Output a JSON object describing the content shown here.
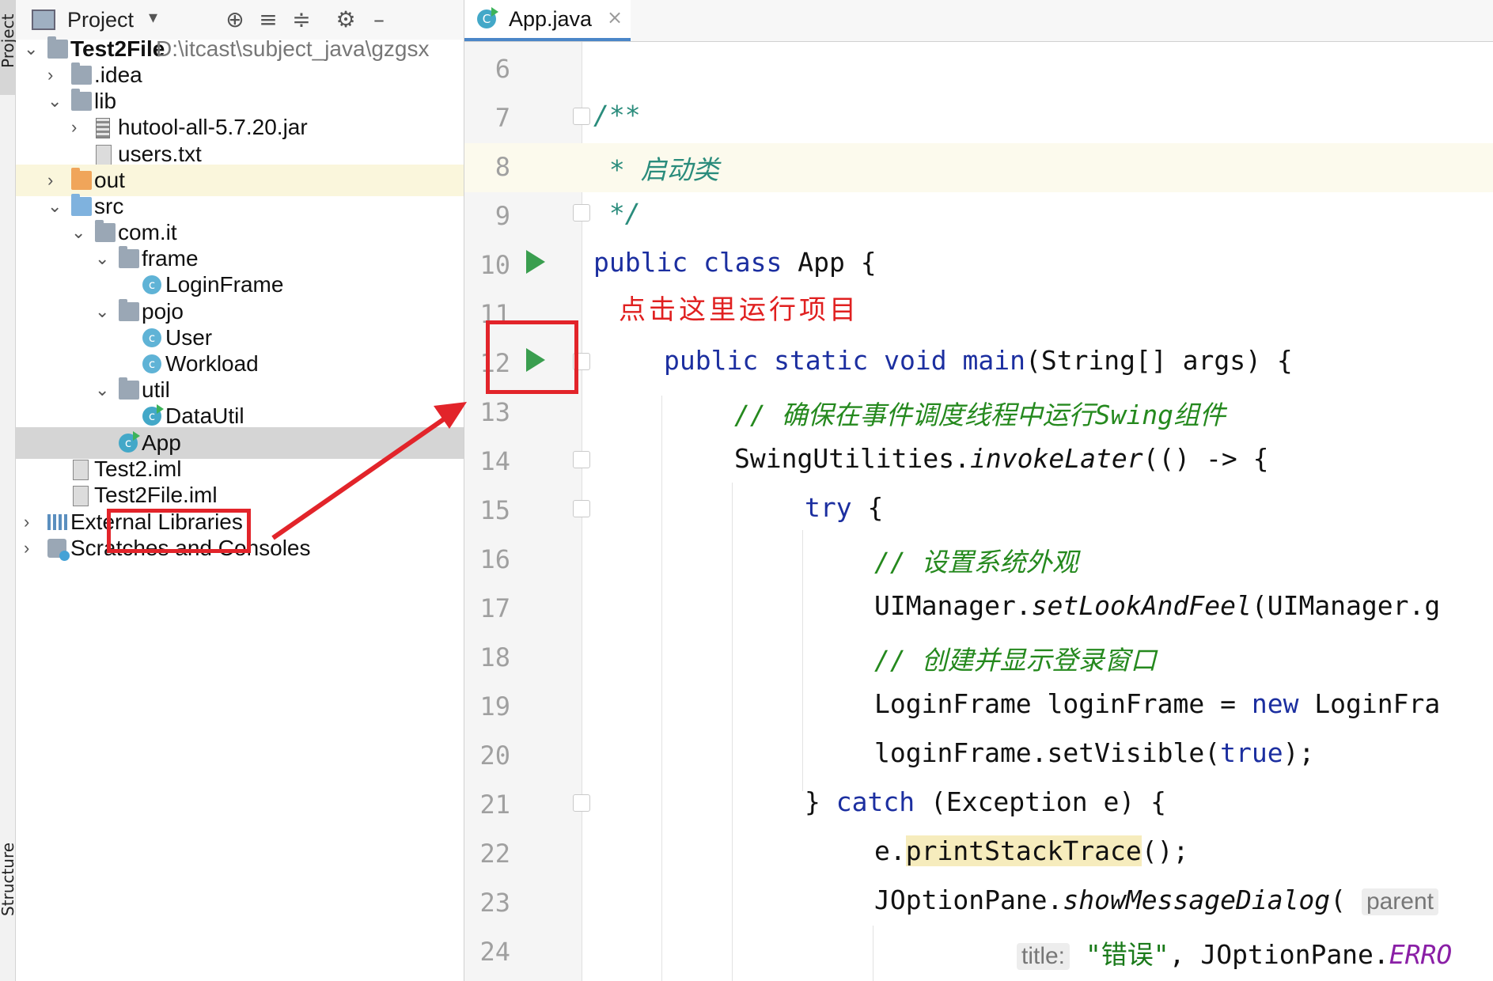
{
  "tool_strip": {
    "project_tab": "Project",
    "structure_tab": "Structure"
  },
  "project_panel": {
    "title": "Project",
    "header_icons": [
      "crosshair-icon",
      "expand-all-icon",
      "collapse-all-icon",
      "gear-icon",
      "minimize-icon"
    ],
    "tree": {
      "root_name": "Test2File",
      "root_path": "D:\\itcast\\subject_java\\gzgsx",
      "idea": ".idea",
      "lib": "lib",
      "jar": "hutool-all-5.7.20.jar",
      "users": "users.txt",
      "out": "out",
      "src": "src",
      "com_it": "com.it",
      "frame": "frame",
      "login_frame": "LoginFrame",
      "pojo": "pojo",
      "user": "User",
      "workload": "Workload",
      "util": "util",
      "data_util": "DataUtil",
      "app": "App",
      "test2_iml": "Test2.iml",
      "test2file_iml": "Test2File.iml",
      "external_libraries": "External Libraries",
      "scratches": "Scratches and Consoles"
    }
  },
  "editor": {
    "tab_label": "App.java",
    "tab_icon_letter": "C",
    "class_icon_letter": "c",
    "line_numbers": [
      "6",
      "7",
      "8",
      "9",
      "10",
      "11",
      "12",
      "13",
      "14",
      "15",
      "16",
      "17",
      "18",
      "19",
      "20",
      "21",
      "22",
      "23",
      "24"
    ],
    "code": {
      "l7": "/**",
      "l8_star": " * ",
      "l8_text": "启动类",
      "l9": " */",
      "l10_kw": "public class",
      "l10_rest": " App {",
      "l12_kw1": "public static void",
      "l12_fn": " main",
      "l12_rest": "(String[] args) {",
      "l13_comment": "// 确保在事件调度线程中运行Swing组件",
      "l14_a": "SwingUtilities.",
      "l14_b": "invokeLater",
      "l14_c": "(() -> {",
      "l15_kw": "try",
      "l15_rest": " {",
      "l16_comment": "// 设置系统外观",
      "l17_a": "UIManager.",
      "l17_b": "setLookAndFeel",
      "l17_c": "(UIManager.g",
      "l18_comment": "// 创建并显示登录窗口",
      "l19_a": "LoginFrame loginFrame = ",
      "l19_kw": "new",
      "l19_rest": " LoginFra",
      "l20_a": "loginFrame.setVisible(",
      "l20_kw": "true",
      "l20_rest": ");",
      "l21_a": "} ",
      "l21_kw": "catch",
      "l21_rest": " (Exception e) {",
      "l22_a": "e.",
      "l22_hl": "printStackTrace",
      "l22_rest": "();",
      "l23_a": "JOptionPane.",
      "l23_b": "showMessageDialog",
      "l23_c": "(",
      "l23_hint": "parent",
      "l24_hint": "title:",
      "l24_str": " \"错误\"",
      "l24_mid": ", JOptionPane.",
      "l24_const": "ERRO"
    }
  },
  "annotation": {
    "text": "点击这里运行项目",
    "color": "#e2242a"
  }
}
